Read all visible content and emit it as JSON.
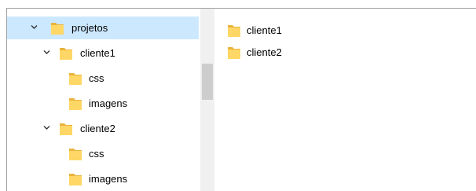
{
  "navigation": {
    "items": [
      {
        "label": "projetos",
        "expanded": true,
        "selected": true
      },
      {
        "label": "cliente1",
        "expanded": true,
        "selected": false
      },
      {
        "label": "css",
        "selected": false
      },
      {
        "label": "imagens",
        "selected": false
      },
      {
        "label": "cliente2",
        "expanded": true,
        "selected": false
      },
      {
        "label": "css",
        "selected": false
      },
      {
        "label": "imagens",
        "selected": false
      }
    ]
  },
  "content": {
    "items": [
      {
        "label": "cliente1",
        "icon": "folder-icon"
      },
      {
        "label": "cliente2",
        "icon": "folder-icon"
      }
    ]
  },
  "colors": {
    "selection": "#cce8ff",
    "folder_front": "#ffd766",
    "folder_back": "#e8b43c",
    "scrollbar_track": "#f0f0f0",
    "scrollbar_thumb": "#cdcdcd"
  }
}
